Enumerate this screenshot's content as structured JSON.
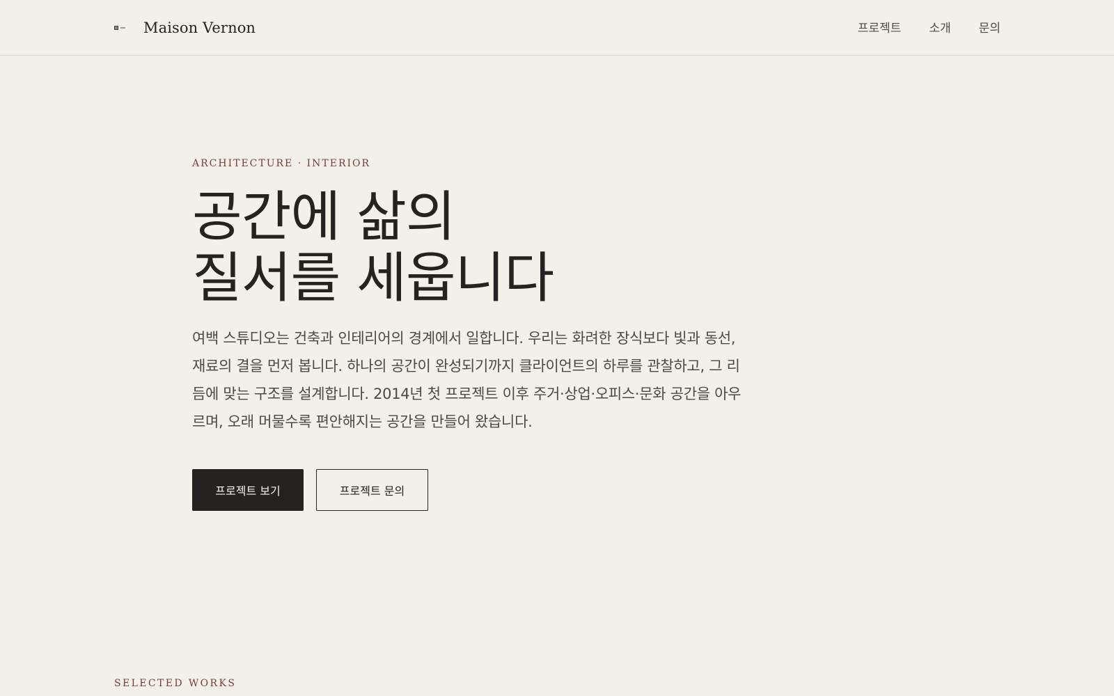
{
  "header": {
    "brand_name": "Maison Vernon",
    "logo_icon": "brand-mark-icon",
    "nav": [
      {
        "label": "프로젝트"
      },
      {
        "label": "소개"
      },
      {
        "label": "문의"
      }
    ]
  },
  "hero": {
    "eyebrow": "ARCHITECTURE · INTERIOR",
    "headline_lines": [
      "공간에 삶의",
      "질서를 세웁니다"
    ],
    "description": "여백 스튜디오는 건축과 인테리어의 경계에서 일합니다. 우리는 화려한 장식보다 빛과 동선, 재료의 결을 먼저 봅니다. 하나의 공간이 완성되기까지 클라이언트의 하루를 관찰하고, 그 리듬에 맞는 구조를 설계합니다. 2014년 첫 프로젝트 이후 주거·상업·오피스·문화 공간을 아우르며, 오래 머물수록 편안해지는 공간을 만들어 왔습니다.",
    "buttons": {
      "primary": "프로젝트 보기",
      "secondary": "프로젝트 문의"
    }
  },
  "sections": {
    "selected_works": "SELECTED WORKS"
  },
  "colors": {
    "background": "#f3f0ea",
    "text": "#25221f",
    "accent": "#7a3d36",
    "border": "#d8d3cb"
  }
}
